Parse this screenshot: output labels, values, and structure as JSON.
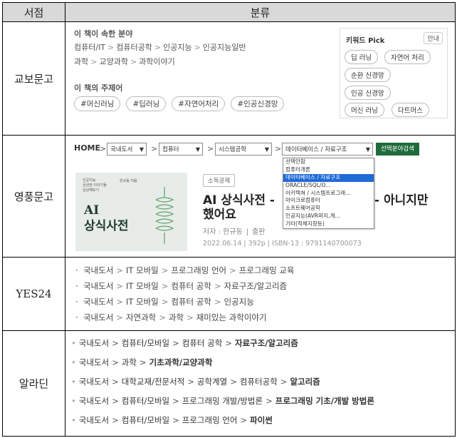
{
  "header": {
    "col1": "서점",
    "col2": "분류"
  },
  "kyobo": {
    "store": "교보문고",
    "field_label": "이 책이 속한 분야",
    "paths": [
      [
        "컴퓨터/IT",
        "컴퓨터공학",
        "인공지능",
        "인공지능일반"
      ],
      [
        "과학",
        "교양과학",
        "과학이야기"
      ]
    ],
    "topic_label": "이 책의 주제어",
    "tags": [
      "#머신러닝",
      "#딥러닝",
      "#자연어처리",
      "#인공신경망"
    ],
    "keyword_pick": {
      "title": "키워드 Pick",
      "guide": "안내",
      "chips": [
        "딥 러닝",
        "자연어 처리",
        "순환 신경망",
        "인공 신경망",
        "머신 러닝",
        "다트머스"
      ]
    }
  },
  "youngpoong": {
    "store": "영풍문고",
    "home": "HOME",
    "selects": [
      "국내도서",
      "컴퓨터",
      "시스템공학",
      "데이터베이스 / 자료구조"
    ],
    "search_button": "선택분야검색",
    "dropdown_options": [
      "선택안함",
      "컴퓨터개론",
      "데이타베이스 / 자료구조",
      "ORACLE/SQL/O...",
      "아키텍쳐 / 시스템프로그래...",
      "마이크로컴퓨터",
      "소프트웨어공학",
      "인공지능(AVR퍼지,계...",
      "기타(적체지향등)"
    ],
    "dropdown_selected": 2,
    "badge": "소득공제",
    "title_line1": "AI 상식사전 -",
    "title_tail": "- 아니지만",
    "title_line2": "했어요",
    "author": "저자 : 한규동",
    "publisher": "출판",
    "meta": "2022.06.14 | 392p | ISBN-13 : 9791140700073",
    "cover_small": "인공지능\n궁금한 이야기들\n상상해보기",
    "cover_title": "AI\n상식사전",
    "cover_author": "한규동 지음"
  },
  "yes24": {
    "store": "YES24",
    "rows": [
      [
        "국내도서",
        "IT 모바일",
        "프로그래밍 언어",
        "프로그래밍 교육"
      ],
      [
        "국내도서",
        "IT 모바일",
        "컴퓨터 공학",
        "자료구조/알고리즘"
      ],
      [
        "국내도서",
        "IT 모바일",
        "컴퓨터 공학",
        "인공지능"
      ],
      [
        "국내도서",
        "자연과학",
        "과학",
        "재미있는 과학이야기"
      ]
    ]
  },
  "aladin": {
    "store": "알라딘",
    "rows": [
      [
        "국내도서",
        "컴퓨터/모바일",
        "컴퓨터 공학",
        "자료구조/알고리즘"
      ],
      [
        "국내도서",
        "과학",
        "기초과학/교양과학"
      ],
      [
        "국내도서",
        "대학교재/전문서적",
        "공학계열",
        "컴퓨터공학",
        "알고리즘"
      ],
      [
        "국내도서",
        "컴퓨터/모바일",
        "프로그래밍 개발/방법론",
        "프로그래밍 기초/개발 방법론"
      ],
      [
        "국내도서",
        "컴퓨터/모바일",
        "프로그래밍 언어",
        "파이썬"
      ]
    ]
  },
  "colors": {
    "header_bg": "#d9d9d9",
    "yp_button": "#1e6b3a",
    "dropdown_selected": "#1e6bd6"
  }
}
